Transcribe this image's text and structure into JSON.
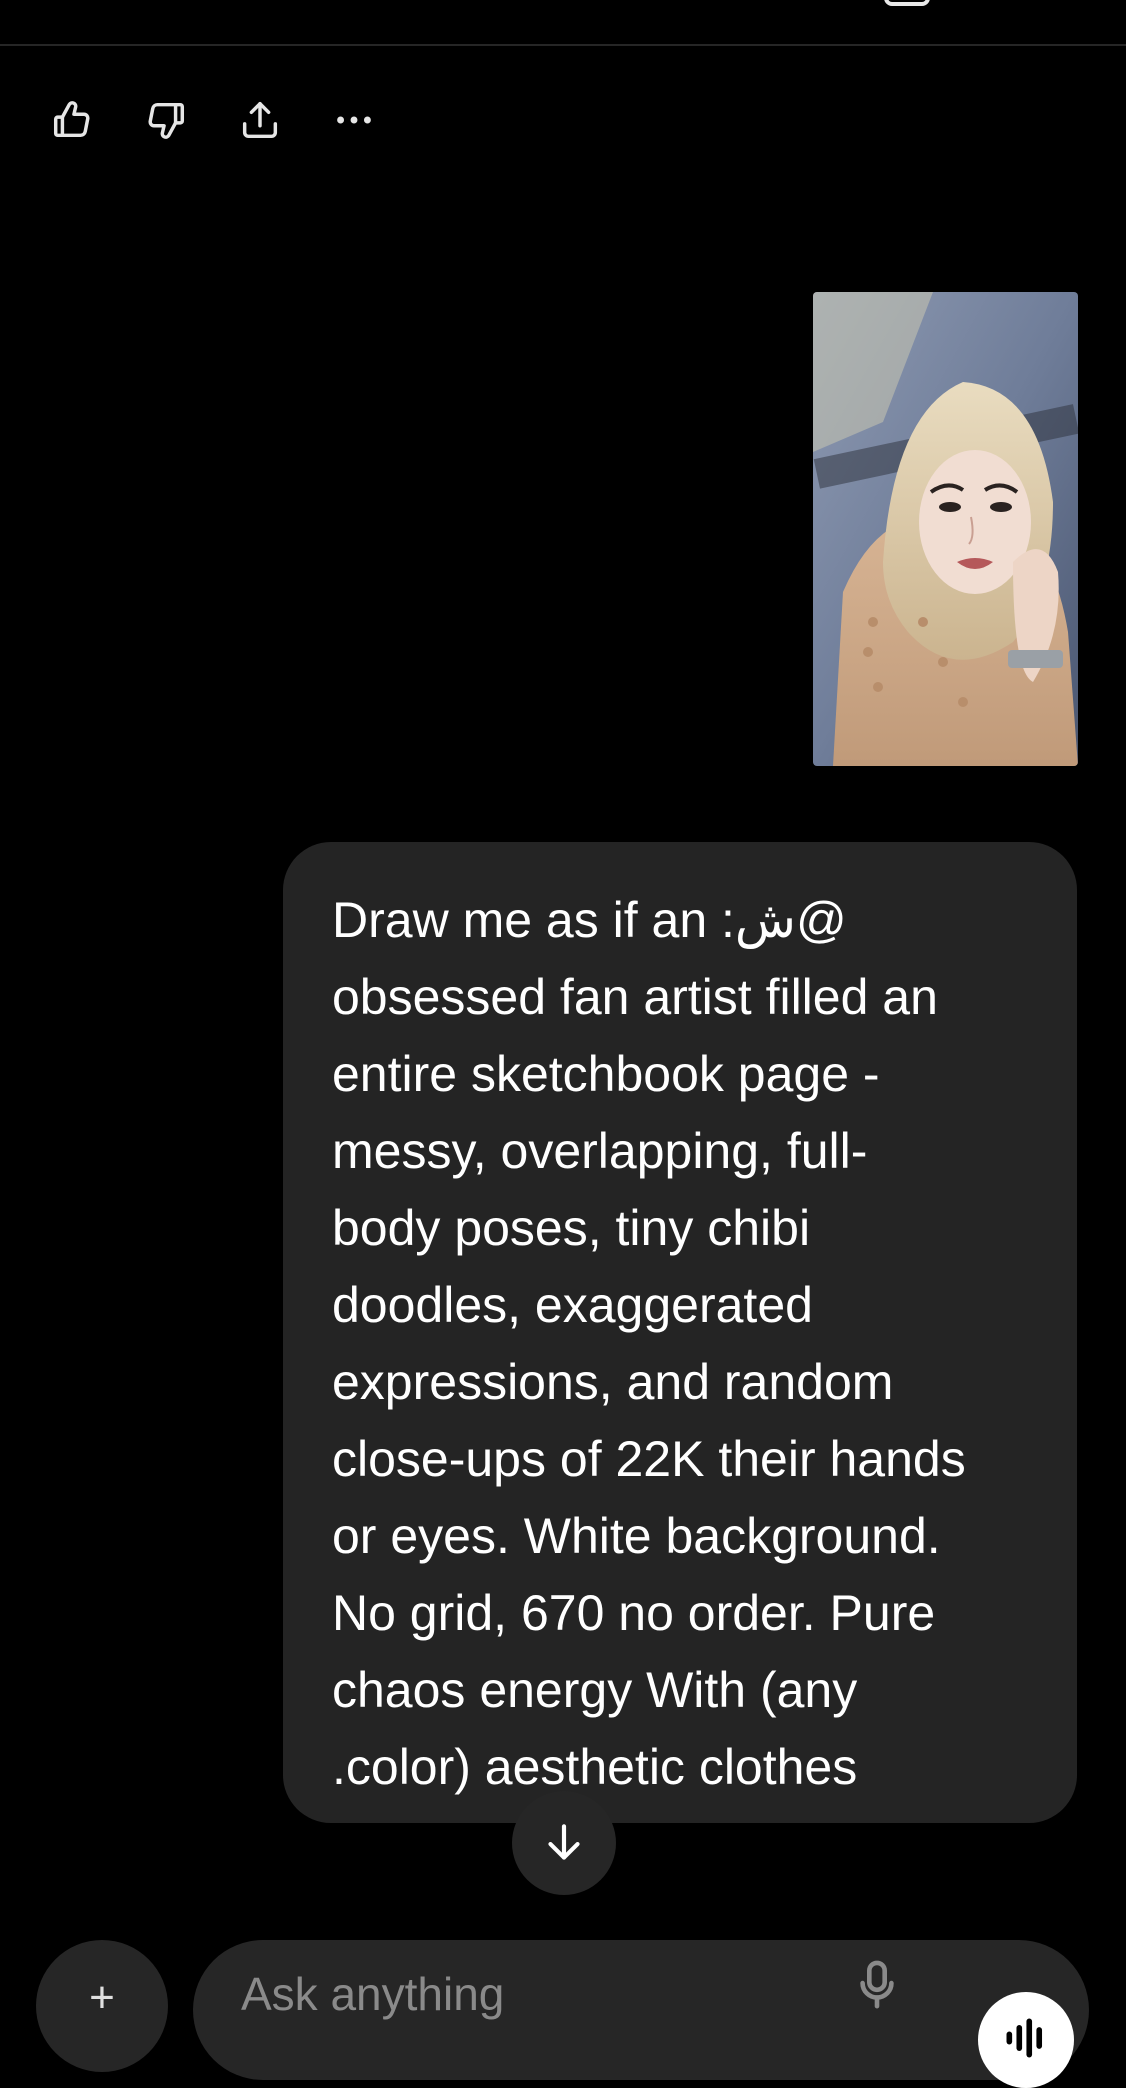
{
  "message": {
    "lines": [
      "Draw me as if an :ش@",
      "obsessed fan artist filled an",
      "entire sketchbook page -",
      "messy, overlapping, full-",
      "body poses, tiny chibi",
      "doodles, exaggerated",
      "expressions, and random",
      "close-ups of 22K their hands",
      "or eyes. White background.",
      "No grid, 670 no order. Pure",
      "chaos energy With (any",
      ".color) aesthetic clothes"
    ]
  },
  "composer": {
    "placeholder": "Ask anything",
    "add_label": "+"
  },
  "icons": {
    "like": "thumbs-up-icon",
    "dislike": "thumbs-down-icon",
    "share": "share-icon",
    "more": "more-icon",
    "scroll": "arrow-down-icon",
    "mic": "microphone-icon",
    "voice": "voice-waveform-icon"
  },
  "colors": {
    "background": "#000000",
    "bubble": "#242424",
    "control": "#262626",
    "text": "#ffffff",
    "placeholder": "#8a8a8a"
  }
}
